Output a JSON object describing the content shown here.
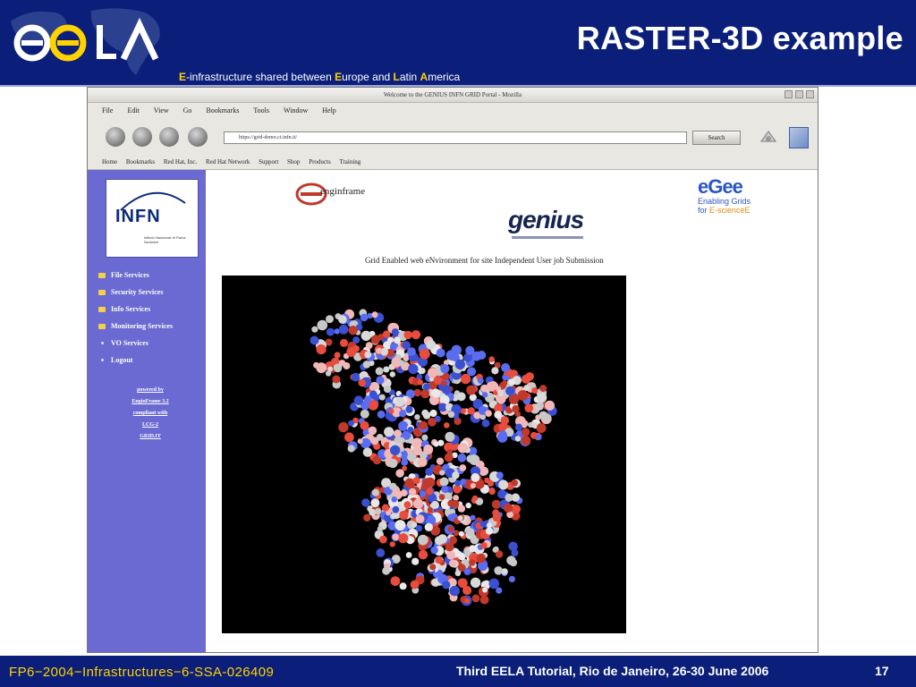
{
  "slide": {
    "title": "RASTER-3D example",
    "tagline": {
      "e": "E",
      "part1": "-infrastructure shared between ",
      "eu": "E",
      "part2": "urope and ",
      "l": "L",
      "part3": "atin ",
      "a": "A",
      "part4": "merica"
    },
    "footer_left": "FP6−2004−Infrastructures−6-SSA-026409",
    "footer_center": "Third EELA Tutorial, Rio de Janeiro, 26-30 June 2006",
    "page_number": "17",
    "colors": {
      "navy": "#0b1f7a",
      "highlight": "#ffd200",
      "sidebar": "#6a6ad2"
    }
  },
  "browser": {
    "window_title": "Welcome to the GENIUS INFN GRID Portal - Mozilla",
    "menu": [
      "File",
      "Edit",
      "View",
      "Go",
      "Bookmarks",
      "Tools",
      "Window",
      "Help"
    ],
    "url": "https://grid-demo.ct.infn.it/",
    "search_label": "Search",
    "bookmarks": [
      "Home",
      "Bookmarks",
      "Red Hat, Inc.",
      "Red Hat Network",
      "Support",
      "Shop",
      "Products",
      "Training"
    ]
  },
  "portal": {
    "infn_logo": "INFN",
    "infn_sub": "Istituto Nazionale di Fisica Nucleare",
    "menu_items": [
      {
        "label": "File Services",
        "icon": "folder-icon"
      },
      {
        "label": "Security Services",
        "icon": "folder-icon"
      },
      {
        "label": "Info Services",
        "icon": "folder-icon"
      },
      {
        "label": "Monitoring Services",
        "icon": "folder-icon"
      },
      {
        "label": "VO Services",
        "icon": "dot-icon"
      },
      {
        "label": "Logout",
        "icon": "dot-icon"
      }
    ],
    "powered_lines": [
      "powered by",
      "EnginFrame 3.2",
      "compliant with",
      "LCG-2",
      "GRID.IT"
    ],
    "enginframe": "enginframe",
    "genius": "genius",
    "caption": "Grid Enabled web eNvironment for site Independent User job Submission",
    "egee_word": "eGee",
    "egee_tag1": "Enabling Grids",
    "egee_tag2_a": "for ",
    "egee_tag2_b": "E-science",
    "egee_tag2_c": "E"
  }
}
